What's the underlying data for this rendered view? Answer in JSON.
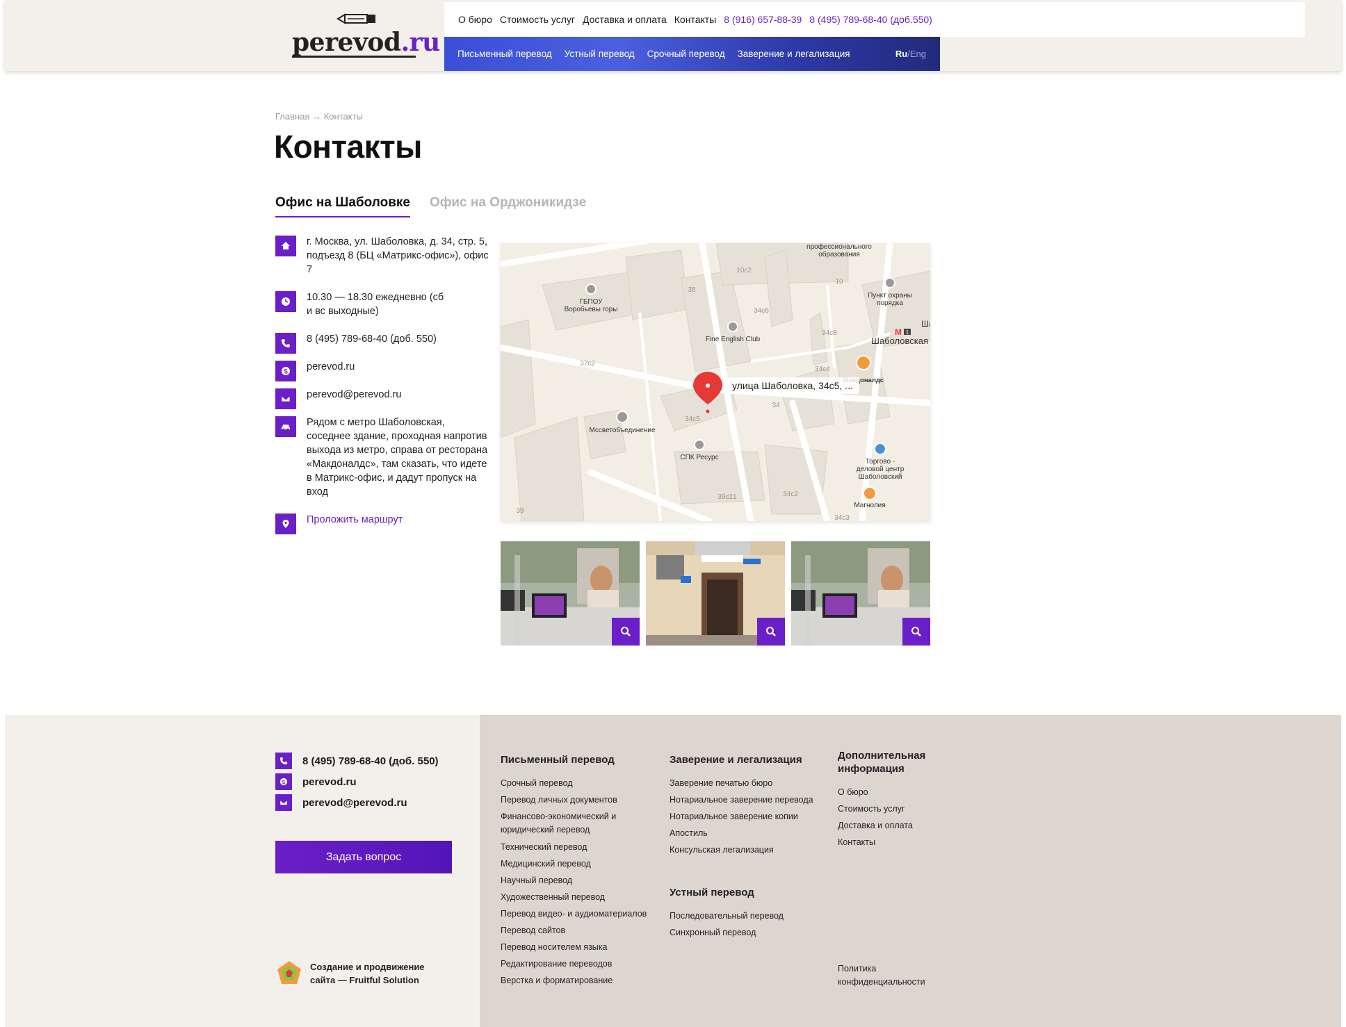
{
  "header": {
    "logo_text": "perevod",
    "logo_suffix": ".ru",
    "top_links": [
      "О бюро",
      "Стоимость услуг",
      "Доставка и оплата",
      "Контакты"
    ],
    "phone1": "8 (916) 657-88-39",
    "phone2": "8 (495) 789-68-40 (доб.550)",
    "main_links": [
      "Письменный перевод",
      "Устный перевод",
      "Срочный перевод",
      "Заверение и легализация"
    ],
    "lang_active": "Ru",
    "lang_sep": "/",
    "lang_other": "Eng"
  },
  "breadcrumb": {
    "home": "Главная",
    "arrow": "→",
    "current": "Контакты"
  },
  "title": "Контакты",
  "tabs": [
    "Офис на Шаболовке",
    "Офис на Орджоникидзе"
  ],
  "contacts": {
    "address": "г. Москва, ул. Шаболовка, д. 34, стр. 5, подъезд 8 (БЦ «Матрикс-офис»), офис 7",
    "hours": "10.30 — 18.30 ежедневно (сб и вс выходные)",
    "phone": "8 (495) 789-68-40 (доб. 550)",
    "skype": "perevod.ru",
    "email": "perevod@perevod.ru",
    "directions": "Рядом с метро Шаболовская, соседнее здание, проходная напротив выхода из метро, справа от ресторана «Макдоналдс», там сказать, что идете в Матрикс-офис, и дадут пропуск на вход",
    "route_link": "Проложить маршрут"
  },
  "map": {
    "pin_label": "улица Шаболовка, 34с5, ...",
    "labels": {
      "prof": "профессионального",
      "obraz": "образования",
      "gbpou": "ГБПОУ",
      "vorobyovy": "Воробьевы горы",
      "fine": "Fine English Club",
      "punkt": "Пункт охраны",
      "poryadka": "порядка",
      "metro": "Шаболовская",
      "shab_cut": "Шабо",
      "mcd": "Макдоналдс",
      "mossvet": "Мссветобъединение",
      "spk": "СПК Ресурс",
      "torg1": "Торгово -",
      "torg2": "деловой центр",
      "torg3": "Шаболовский",
      "magnolia": "Магнолия",
      "b35": "35",
      "b10c2": "10с2",
      "b10": "10",
      "b34c6": "34с6",
      "b34c8": "34с8",
      "b37c2": "37с2",
      "b34c4": "34с4",
      "b34": "34",
      "b34c5": "34с5",
      "b39c21": "39с21",
      "b34c2": "34с2",
      "b34c3": "34с3",
      "b39": "39",
      "metro_num": "1"
    }
  },
  "footer": {
    "phone": "8 (495) 789-68-40 (доб. 550)",
    "skype": "perevod.ru",
    "email": "perevod@perevod.ru",
    "ask_button": "Задать вопрос",
    "fruitful_line1": "Создание и продвижение",
    "fruitful_line2": "сайта — Fruitful Solution",
    "col1_title": "Письменный перевод",
    "col1": [
      "Срочный перевод",
      "Перевод личных документов",
      "Финансово-экономический и юридический перевод",
      "Технический перевод",
      "Медицинский перевод",
      "Научный перевод",
      "Художественный перевод",
      "Перевод видео- и аудиоматериалов",
      "Перевод сайтов",
      "Перевод носителем языка",
      "Редактирование переводов",
      "Верстка и форматирование"
    ],
    "col2_title": "Заверение и легализация",
    "col2": [
      "Заверение печатью бюро",
      "Нотариальное заверение перевода",
      "Нотариальное заверение копии",
      "Апостиль",
      "Консульская легализация"
    ],
    "col2b_title": "Устный перевод",
    "col2b": [
      "Последовательный перевод",
      "Синхронный перевод"
    ],
    "col3_title": "Дополнительная информация",
    "col3": [
      "О бюро",
      "Стоимость услуг",
      "Доставка и оплата",
      "Контакты"
    ],
    "privacy": "Политика конфиденциальности"
  },
  "colors": {
    "accent": "#6a1fc8",
    "footer_left": "#f3f0ec",
    "footer_right": "#dcd6cf"
  }
}
